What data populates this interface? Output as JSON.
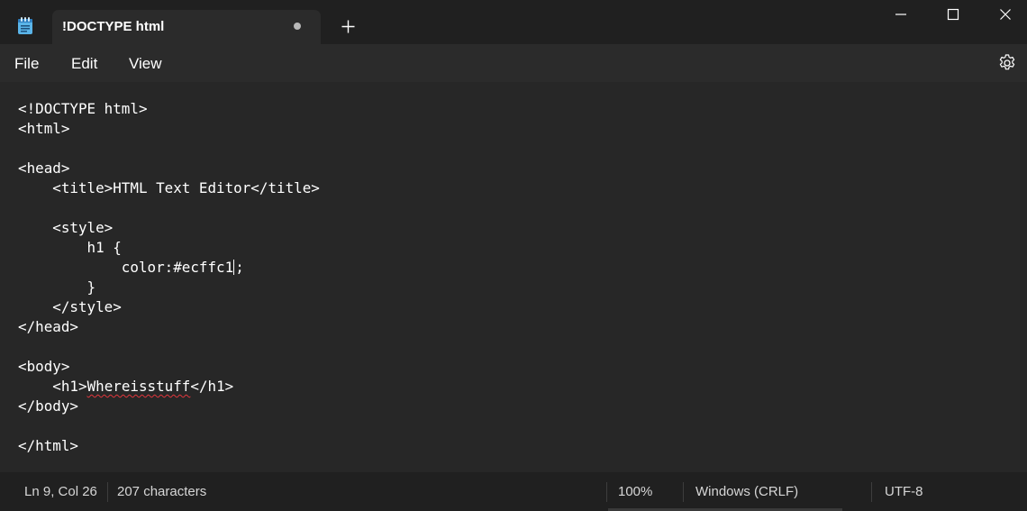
{
  "tab": {
    "title": "!DOCTYPE html",
    "unsaved_indicator": "dot",
    "new_tab_icon": "plus-icon"
  },
  "window_controls": {
    "minimize_icon": "minimize-icon",
    "maximize_icon": "maximize-icon",
    "close_icon": "close-icon"
  },
  "menu": {
    "file": "File",
    "edit": "Edit",
    "view": "View",
    "settings_icon": "gear-icon"
  },
  "editor": {
    "lines": [
      "<!DOCTYPE html>",
      "<html>",
      "",
      "<head>",
      "    <title>HTML Text Editor</title>",
      "",
      "    <style>",
      "        h1 {",
      "            color:#ecffc1;",
      "        }",
      "    </style>",
      "</head>",
      "",
      "<body>",
      "    <h1>Whereisstuff</h1>",
      "</body>",
      "",
      "</html>"
    ],
    "line9_before_cursor": "            color:#ecffc1",
    "line9_after_cursor": ";",
    "line15_indent": "    ",
    "line15_open": "<h1>",
    "line15_misspelled": "Whereisstuff",
    "line15_close": "</h1>"
  },
  "status": {
    "position": "Ln 9, Col 26",
    "characters": "207 characters",
    "zoom": "100%",
    "line_ending": "Windows (CRLF)",
    "encoding": "UTF-8"
  },
  "colors": {
    "titlebar_bg": "#202020",
    "tab_bg": "#2b2b2b",
    "editor_bg": "#272727",
    "text": "#ffffff",
    "spellcheck": "#e0363c",
    "app_icon": "#5ab4e8"
  }
}
